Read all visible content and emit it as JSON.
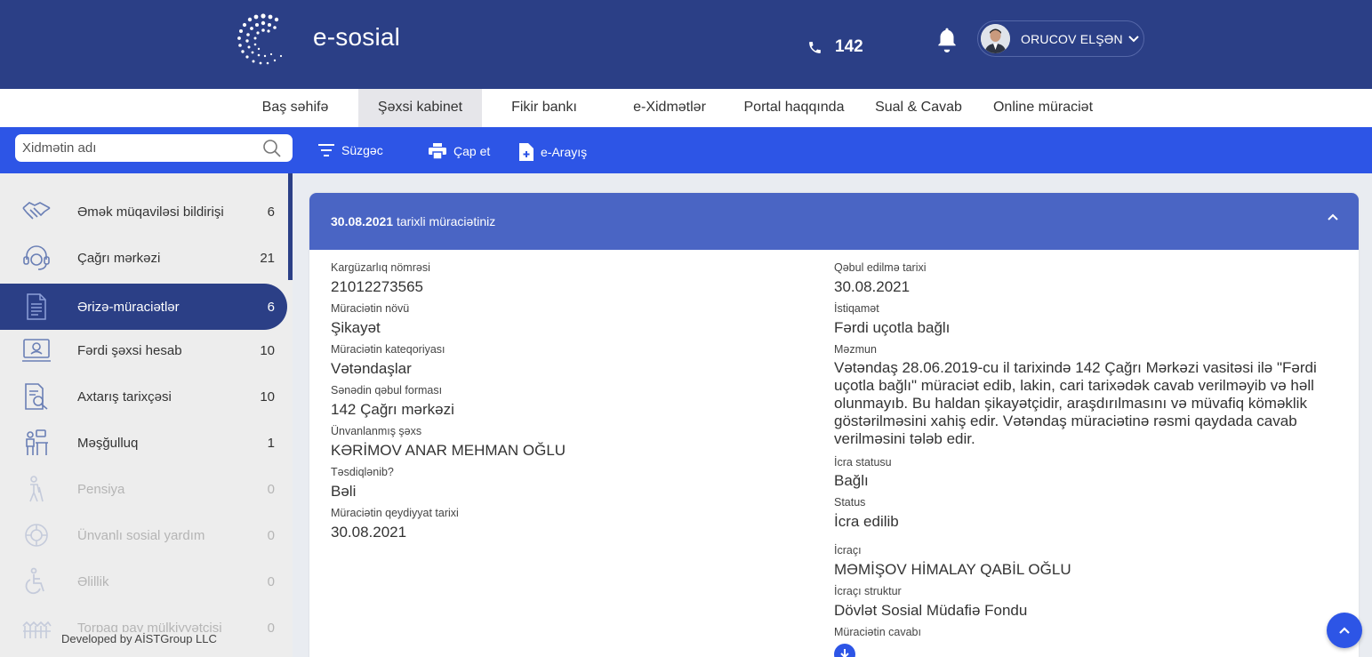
{
  "header": {
    "brand": "e-sosial",
    "phone": "142",
    "username": "ORUCOV ELŞƏN"
  },
  "nav": {
    "items": [
      {
        "label": "Baş səhifə"
      },
      {
        "label": "Şəxsi kabinet",
        "active": true
      },
      {
        "label": "Fikir bankı"
      },
      {
        "label": "e-Xidmətlər"
      },
      {
        "label": "Portal haqqında"
      },
      {
        "label": "Sual & Cavab"
      },
      {
        "label": "Online müraciət"
      }
    ]
  },
  "toolbar": {
    "search_placeholder": "Xidmətin adı",
    "filter_label": "Süzgəc",
    "print_label": "Çap et",
    "certificate_label": "e-Arayış"
  },
  "sidebar": {
    "items": [
      {
        "label": "Əmək müqaviləsi bildirişi",
        "count": "6",
        "icon": "handshake-icon"
      },
      {
        "label": "Çağrı mərkəzi",
        "count": "21",
        "icon": "headset-icon"
      },
      {
        "label": "Ərizə-müraciətlər",
        "count": "6",
        "icon": "document-icon",
        "active": true
      },
      {
        "label": "Fərdi şəxsi hesab",
        "count": "10",
        "icon": "monitor-account-icon"
      },
      {
        "label": "Axtarış tarixçəsi",
        "count": "10",
        "icon": "search-history-icon"
      },
      {
        "label": "Məşğulluq",
        "count": "1",
        "icon": "employment-icon"
      },
      {
        "label": "Pensiya",
        "count": "0",
        "icon": "pension-icon",
        "disabled": true
      },
      {
        "label": "Ünvanlı sosial yardım",
        "count": "0",
        "icon": "social-aid-icon",
        "disabled": true
      },
      {
        "label": "Əlillik",
        "count": "0",
        "icon": "wheelchair-icon",
        "disabled": true
      },
      {
        "label": "Torpaq pay mülkiyyətçisi",
        "count": "0",
        "icon": "land-icon",
        "disabled": true
      }
    ],
    "credit": "Developed by AİSTGroup LLC"
  },
  "card": {
    "date": "30.08.2021",
    "title_suffix": "tarixli müraciətiniz",
    "left": [
      {
        "label": "Kargüzarlıq nömrəsi",
        "value": "21012273565"
      },
      {
        "label": "Müraciətin növü",
        "value": "Şikayət"
      },
      {
        "label": "Müraciətin kateqoriyası",
        "value": "Vətəndaşlar"
      },
      {
        "label": "Sənədin qəbul forması",
        "value": "142 Çağrı mərkəzi"
      },
      {
        "label": "Ünvanlanmış şəxs",
        "value": "KƏRİMOV ANAR MEHMAN OĞLU"
      },
      {
        "label": "Təsdiqlənib?",
        "value": "Bəli"
      },
      {
        "label": "Müraciətin qeydiyyat tarixi",
        "value": "30.08.2021"
      }
    ],
    "right": {
      "accepted_label": "Qəbul edilmə tarixi",
      "accepted_value": "30.08.2021",
      "direction_label": "İstiqamət",
      "direction_value": "Fərdi uçotla bağlı",
      "content_label": "Məzmun",
      "content_lines": [
        "Vətəndaş 28.06.2019-cu il tarixində 142 Çağrı Mərkəzi vasitəsi ilə \"Fərdi",
        "uçotla bağlı\" müraciət edib, lakin, cari tarixədək cavab verilməyib və həll",
        "olunmayıb. Bu haldan şikayətçidir, araşdırılmasını və müvafiq köməklik",
        "göstərilməsini xahiş edir. Vətəndaş müraciətinə rəsmi qaydada cavab",
        "verilməsini tələb edir."
      ],
      "exec_status_label": "İcra statusu",
      "exec_status_value": "Bağlı",
      "status_label": "Status",
      "status_value": "İcra edilib",
      "executor_label": "İcraçı",
      "executor_value": "MƏMİŞOV HİMALAY QABİL OĞLU",
      "executor_struct_label": "İcraçı struktur",
      "executor_struct_value": "Dövlət Sosial Müdafiə Fondu",
      "answer_label": "Müraciətin cavabı"
    }
  },
  "colors": {
    "header": "#2b3f86",
    "toolbar": "#2d55e6",
    "card_head": "#4a65c4"
  }
}
